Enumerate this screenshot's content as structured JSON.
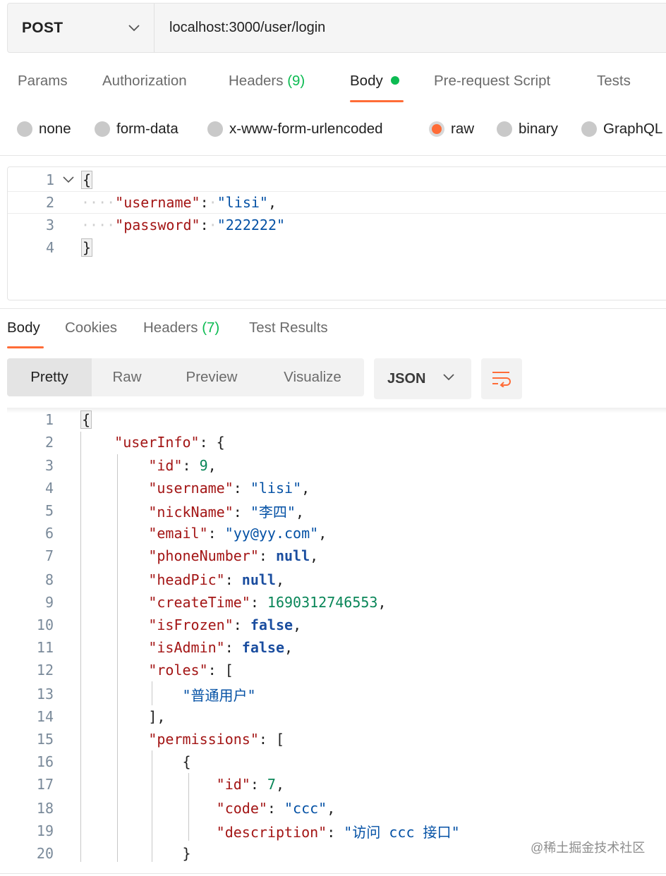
{
  "request": {
    "method": "POST",
    "url": "localhost:3000/user/login"
  },
  "request_tabs": [
    {
      "label": "Params"
    },
    {
      "label": "Authorization"
    },
    {
      "label": "Headers",
      "count": "(9)"
    },
    {
      "label": "Body",
      "active": true
    },
    {
      "label": "Pre-request Script"
    },
    {
      "label": "Tests"
    }
  ],
  "body_types": [
    "none",
    "form-data",
    "x-www-form-urlencoded",
    "raw",
    "binary",
    "GraphQL"
  ],
  "body_type_selected": "raw",
  "request_body_lines": [
    {
      "n": "1"
    },
    {
      "n": "2"
    },
    {
      "n": "3"
    },
    {
      "n": "4"
    }
  ],
  "request_body": {
    "username": "lisi",
    "password": "222222"
  },
  "response_tabs": [
    {
      "label": "Body",
      "active": true
    },
    {
      "label": "Cookies"
    },
    {
      "label": "Headers",
      "count": "(7)"
    },
    {
      "label": "Test Results"
    }
  ],
  "view_modes": [
    "Pretty",
    "Raw",
    "Preview",
    "Visualize"
  ],
  "view_mode_selected": "Pretty",
  "format": "JSON",
  "response": {
    "userInfo": {
      "id": "9",
      "username": "lisi",
      "nickName": "李四",
      "email": "yy@yy.com",
      "phoneNumber": "null",
      "headPic": "null",
      "createTime": "1690312746553",
      "isFrozen": "false",
      "isAdmin": "false",
      "roles": [
        "普通用户"
      ],
      "permissions": [
        {
          "id": "7",
          "code": "ccc",
          "description": "访问 ccc 接口"
        }
      ]
    }
  },
  "watermark": "@稀土掘金技术社区",
  "colors": {
    "accent": "#ff6c37",
    "count_green": "#0cbb52",
    "json_key": "#a31515",
    "json_string": "#0451a5",
    "json_number": "#098658",
    "json_keyword": "#1a4d9f"
  }
}
